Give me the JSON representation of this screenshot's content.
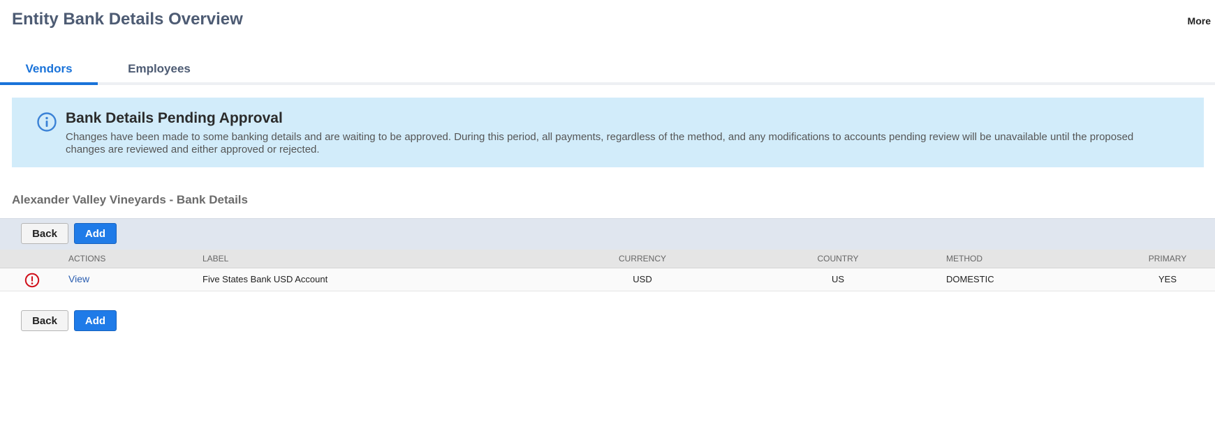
{
  "header": {
    "title": "Entity Bank Details Overview",
    "more_label": "More"
  },
  "tabs": [
    {
      "label": "Vendors",
      "active": true
    },
    {
      "label": "Employees",
      "active": false
    }
  ],
  "banner": {
    "icon": "info-icon",
    "title": "Bank Details Pending Approval",
    "text": "Changes have been made to some banking details and are waiting to be approved. During this period, all payments, regardless of the method, and any modifications to accounts pending review will be unavailable until the proposed changes are reviewed and either approved or rejected."
  },
  "section": {
    "title": "Alexander Valley Vineyards - Bank Details"
  },
  "buttons": {
    "back_label": "Back",
    "add_label": "Add"
  },
  "table": {
    "columns": [
      "ACTIONS",
      "LABEL",
      "CURRENCY",
      "COUNTRY",
      "METHOD",
      "PRIMARY"
    ],
    "rows": [
      {
        "status_icon": "warning-icon",
        "action": "View",
        "label": "Five States Bank USD Account",
        "currency": "USD",
        "country": "US",
        "method": "DOMESTIC",
        "primary": "YES"
      }
    ]
  },
  "colors": {
    "accent": "#1a73d9",
    "banner_bg": "#d2ecfa",
    "warning": "#d0101b",
    "toolbar_bg": "#e0e6ef"
  }
}
